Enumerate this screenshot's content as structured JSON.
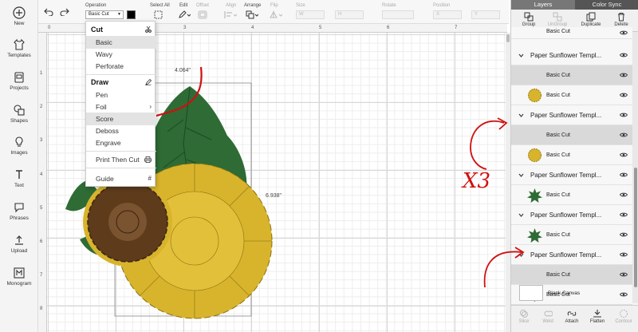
{
  "sidebar": {
    "items": [
      {
        "label": "New",
        "icon": "plus-icon"
      },
      {
        "label": "Templates",
        "icon": "shirt-icon"
      },
      {
        "label": "Projects",
        "icon": "projects-icon"
      },
      {
        "label": "Shapes",
        "icon": "shapes-icon"
      },
      {
        "label": "Images",
        "icon": "lightbulb-icon"
      },
      {
        "label": "Text",
        "icon": "text-icon"
      },
      {
        "label": "Phrases",
        "icon": "speech-bubble-icon"
      },
      {
        "label": "Upload",
        "icon": "upload-icon"
      },
      {
        "label": "Monogram",
        "icon": "monogram-icon"
      }
    ]
  },
  "toolbar": {
    "operation_label": "Operation",
    "operation_value": "Basic Cut",
    "select_all": "Select All",
    "edit": "Edit",
    "offset": "Offset",
    "align": "Align",
    "arrange": "Arrange",
    "flip": "Flip",
    "size": "Size",
    "rotate": "Rotate",
    "position": "Position",
    "size_w_placeholder": "W",
    "size_h_placeholder": "H",
    "pos_x_placeholder": "X",
    "pos_y_placeholder": "Y"
  },
  "rulers": {
    "top": [
      "0",
      "1",
      "2",
      "3",
      "4",
      "5",
      "6",
      "7"
    ],
    "left": [
      "1",
      "2",
      "3",
      "4",
      "5",
      "6",
      "7",
      "8"
    ]
  },
  "operation_menu": {
    "cut_header": "Cut",
    "cut_items": [
      "Basic",
      "Wavy",
      "Perforate"
    ],
    "draw_header": "Draw",
    "draw_items": [
      "Pen",
      "Foil",
      "Score",
      "Deboss",
      "Engrave"
    ],
    "print_then_cut": "Print Then Cut",
    "guide": "Guide",
    "selected": "Basic",
    "hovered": "Score"
  },
  "dimensions": {
    "width": "4.064\"",
    "height": "6.938\""
  },
  "layers_panel": {
    "tabs": [
      "Layers",
      "Color Sync"
    ],
    "actions": [
      {
        "label": "Group",
        "enabled": true
      },
      {
        "label": "UnGroup",
        "enabled": false
      },
      {
        "label": "Duplicate",
        "enabled": true
      },
      {
        "label": "Delete",
        "enabled": true
      }
    ],
    "rows": [
      {
        "kind": "child",
        "label": "Basic Cut",
        "swatch": "none"
      },
      {
        "kind": "group",
        "label": "Paper Sunflower Templ..."
      },
      {
        "kind": "child",
        "label": "Basic Cut",
        "swatch": "blank",
        "selected": true
      },
      {
        "kind": "child",
        "label": "Basic Cut",
        "swatch": "yellow-flower"
      },
      {
        "kind": "group",
        "label": "Paper Sunflower Templ..."
      },
      {
        "kind": "child",
        "label": "Basic Cut",
        "swatch": "blank",
        "selected": true
      },
      {
        "kind": "child",
        "label": "Basic Cut",
        "swatch": "yellow-flower"
      },
      {
        "kind": "group",
        "label": "Paper Sunflower Templ..."
      },
      {
        "kind": "child",
        "label": "Basic Cut",
        "swatch": "green-star"
      },
      {
        "kind": "group",
        "label": "Paper Sunflower Templ..."
      },
      {
        "kind": "child",
        "label": "Basic Cut",
        "swatch": "green-star"
      },
      {
        "kind": "group",
        "label": "Paper Sunflower Templ..."
      },
      {
        "kind": "child",
        "label": "Basic Cut",
        "swatch": "blank",
        "selected": true
      },
      {
        "kind": "child",
        "label": "Basic Cut",
        "swatch": "green-leaf"
      }
    ],
    "blank_canvas": "Blank Canvas",
    "bottom_actions": [
      {
        "label": "Slice",
        "enabled": false
      },
      {
        "label": "Weld",
        "enabled": false
      },
      {
        "label": "Attach",
        "enabled": true
      },
      {
        "label": "Flatten",
        "enabled": true
      },
      {
        "label": "Contour",
        "enabled": false
      }
    ]
  },
  "annotation": {
    "handwritten": "X3"
  },
  "colors": {
    "leaf_green": "#2e6b35",
    "sunflower_yellow": "#d8b42c",
    "center_brown": "#5d3b1b",
    "annotation_red": "#d01010"
  }
}
